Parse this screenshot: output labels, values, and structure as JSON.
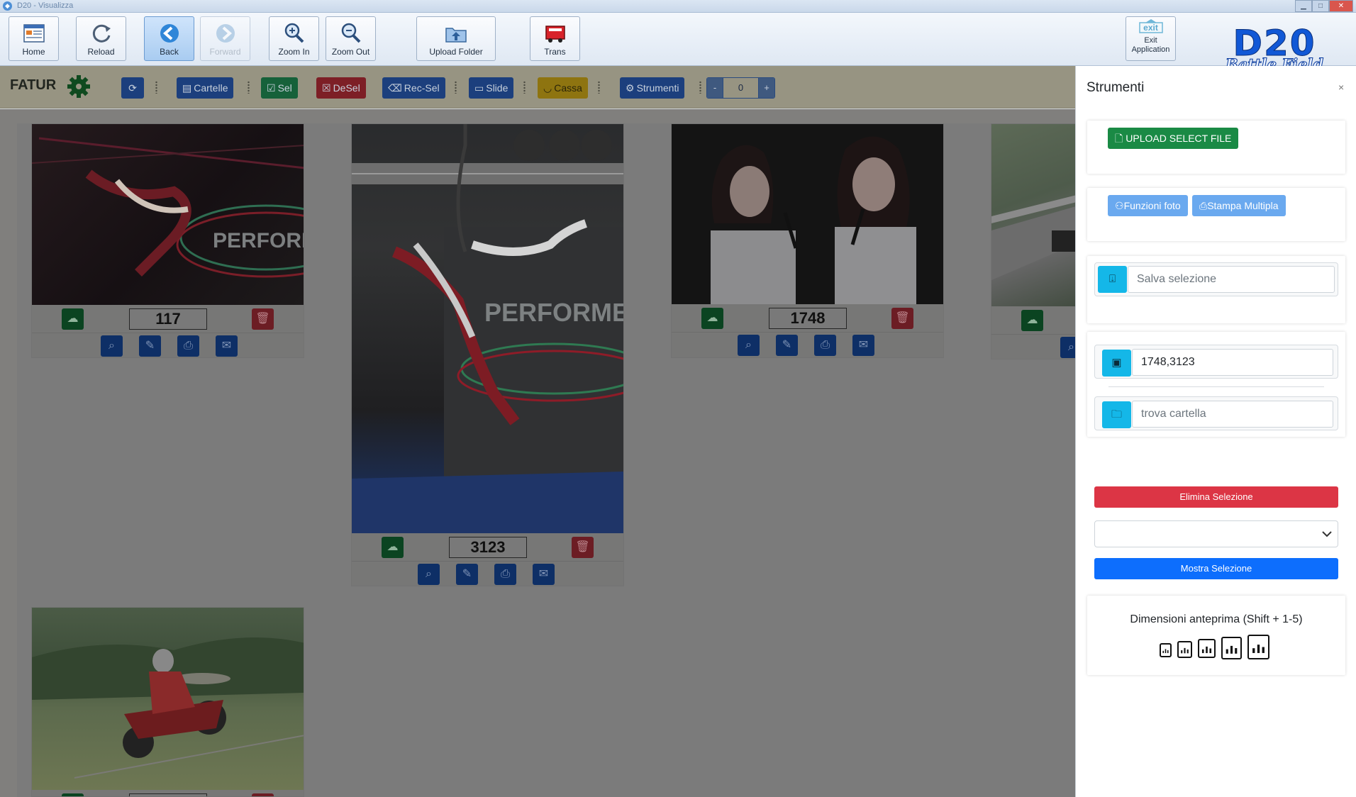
{
  "window": {
    "title": "D20 - Visualizza"
  },
  "toolbar": {
    "home_label": "Home",
    "reload_label": "Reload",
    "back_label": "Back",
    "forward_label": "Forward",
    "zoom_in_label": "Zoom In",
    "zoom_out_label": "Zoom Out",
    "upload_folder_label": "Upload Folder",
    "trans_label": "Trans",
    "exit_badge": "exit",
    "exit_line1": "Exit",
    "exit_line2": "Application",
    "logo_main": "D20",
    "logo_sub": "Battle Field"
  },
  "subbar": {
    "brand": "FATUR",
    "cartelle_label": "Cartelle",
    "sel_label": "Sel",
    "desel_label": "DeSel",
    "recsel_label": "Rec-Sel",
    "slide_label": "Slide",
    "cassa_label": "Cassa",
    "strumenti_label": "Strumenti",
    "stepper": {
      "minus": "-",
      "value": "0",
      "plus": "+"
    }
  },
  "gallery": {
    "cards": [
      {
        "number": "117",
        "banner": "PERFORME"
      },
      {
        "number": "3123",
        "banner": "PERFORME"
      },
      {
        "number": "1748",
        "banner": ""
      },
      {
        "number": "",
        "banner": ""
      },
      {
        "number": "",
        "banner": ""
      }
    ]
  },
  "panel": {
    "title": "Strumenti",
    "close": "×",
    "upload_select_file": "UPLOAD SELECT FILE",
    "funzioni_foto": "Funzioni foto",
    "stampa_multipla": "Stampa Multipla",
    "salva_selezione_placeholder": "Salva selezione",
    "selection_value": "1748,3123",
    "trova_cartella_placeholder": "trova cartella",
    "elimina_selezione": "Elimina Selezione",
    "dropdown_value": "",
    "mostra_selezione": "Mostra Selezione",
    "dimensioni_label": "Dimensioni anteprima (Shift + 1-5)"
  },
  "colors": {
    "accent_blue": "#0d6efd",
    "info_cyan": "#14b7e8",
    "danger_red": "#dc3545",
    "success_green": "#1a8a45"
  }
}
